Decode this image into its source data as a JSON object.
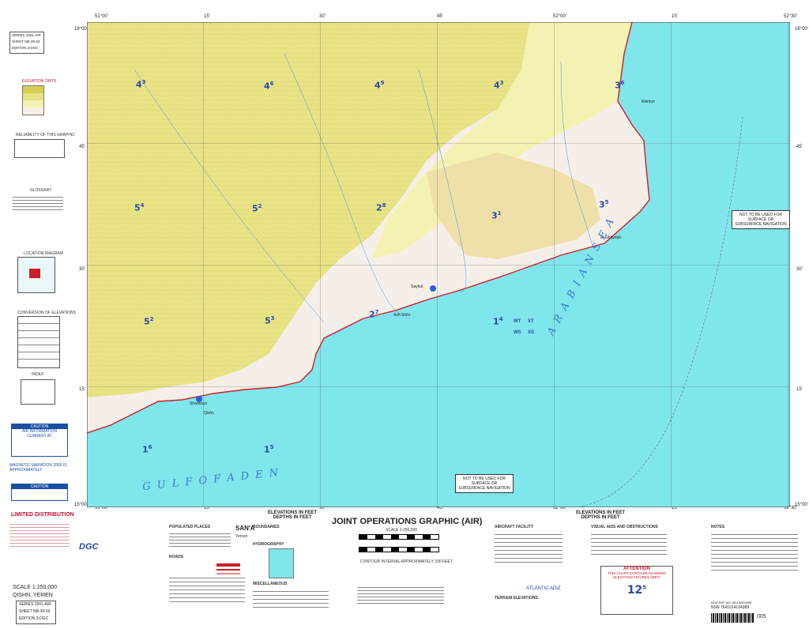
{
  "header": {
    "series_label": "SERIES",
    "series_value": "1501-AIR",
    "sheet_label": "SHEET",
    "sheet_value": "NB-39-03",
    "edition_label": "EDITION",
    "edition_value": "3-DGC",
    "top_coords": [
      "51°00'",
      "15'",
      "30'",
      "45'",
      "52°00'",
      "15'",
      "52°30'"
    ],
    "right_coords": [
      "16°00'",
      "45'",
      "30'",
      "15'",
      "15°00'"
    ],
    "left_coords": [
      "16°00'",
      "45'",
      "30'",
      "15'",
      "15°00'"
    ],
    "bottom_coords": [
      "51°00'",
      "15'",
      "30'",
      "45'",
      "52°00'",
      "15'",
      "52°30'"
    ]
  },
  "map": {
    "sea_labels": [
      "A R A B I A N  S E A",
      "G U L F  O F  A D E N"
    ],
    "warning_1": "NOT TO BE USED FOR SURFACE OR SUBSURFACE NAVIGATION",
    "warning_2": "NOT TO BE USED FOR SURFACE OR SUBSURFACE NAVIGATION",
    "sheet_numbers": [
      {
        "n": "4",
        "s": "3"
      },
      {
        "n": "4",
        "s": "6"
      },
      {
        "n": "4",
        "s": "9"
      },
      {
        "n": "4",
        "s": "3"
      },
      {
        "n": "3",
        "s": "6"
      },
      {
        "n": "5",
        "s": "4"
      },
      {
        "n": "5",
        "s": "2"
      },
      {
        "n": "2",
        "s": "8"
      },
      {
        "n": "3",
        "s": "1"
      },
      {
        "n": "3",
        "s": "5"
      },
      {
        "n": "5",
        "s": "2"
      },
      {
        "n": "5",
        "s": "3"
      },
      {
        "n": "2",
        "s": "7"
      },
      {
        "n": "1",
        "s": "4"
      },
      {
        "n": "1",
        "s": "6"
      },
      {
        "n": "1",
        "s": "5"
      }
    ],
    "places": [
      "Nishtun",
      "Sayhut",
      "Al Ghaydah",
      "Qishn",
      "Sharwayn",
      "Ash Shihr"
    ],
    "grid_labels": [
      "WT",
      "XT",
      "WS",
      "XS"
    ]
  },
  "left_panel": {
    "elevation_tints_title": "ELEVATION TINTS",
    "reliability_title": "RELIABILITY OF THIS GRAPHIC",
    "glossary_title": "GLOSSARY",
    "location_title": "LOCATION DIAGRAM",
    "conversion_title": "CONVERSION OF ELEVATIONS",
    "index_title": "INDEX",
    "caution_title": "CAUTION",
    "caution_sub": "AIR INFORMATION CURRENT AT",
    "magnetic_title": "MAGNETIC VARIATION 2005 IS APPROXIMATELY",
    "caution2_title": "CAUTION",
    "limited_title": "LIMITED DISTRIBUTION",
    "scale_label": "SCALE 1:250,000",
    "sheet_name": "QISHN, YEMEN",
    "series_label": "SERIES",
    "series_value": "1501-AIR",
    "sheet_label": "SHEET",
    "sheet_value": "NB-39-03",
    "edition_label": "EDITION",
    "edition_value": "3-DGC"
  },
  "bottom": {
    "elev_title_left": "ELEVATIONS IN FEET DEPTHS IN FEET",
    "main_title": "JOINT OPERATIONS GRAPHIC (AIR)",
    "elev_title_right": "ELEVATIONS IN FEET DEPTHS IN FEET",
    "scale_text": "SCALE 1:250,000",
    "contour_note": "CONTOUR INTERVAL APPROXIMATELY 330 FEET",
    "populated_places": "POPULATED PLACES",
    "boundaries": "BOUNDARIES",
    "roads": "ROADS",
    "hydrography": "HYDROGRAPHY",
    "miscellaneous": "MISCELLANEOUS",
    "aircraft_facility": "AIRCRAFT FACILITY",
    "terrain_elevations": "TERRAIN ELEVATIONS",
    "sana": "SAN'A",
    "sana_alt": "Yemen",
    "atlantic": "ATLANTIC ADIZ",
    "visual_aids": "VISUAL AIDS AND OBSTRUCTIONS",
    "attention_title": "ATTENTION",
    "attention_body": "THIS CHART CONTAINS MAXIMUM ELEVATION FIGURES (MEF)",
    "mef_value": "12",
    "mef_sup": "5",
    "notes": "NOTES",
    "dgc_logo": "DGC",
    "nsn": "NSN 7641014104389",
    "nsn2": "NGA REF NO 1501AN03903",
    "barcode_tail": "005"
  },
  "colors": {
    "sea": "#7fe6ec",
    "land_high": "#e8e486",
    "land_mid": "#f4f2b2",
    "land_low": "#f6efe9",
    "coast": "#cc1f2a",
    "grid": "#5a5a5a",
    "accent_blue": "#2a49a8"
  }
}
